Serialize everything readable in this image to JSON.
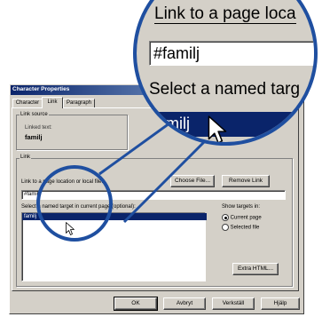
{
  "dialog": {
    "title": "Character Properties",
    "tabs": [
      "Character",
      "Link",
      "Paragraph"
    ],
    "link_source": {
      "group_label": "Link source",
      "linked_text_label": "Linked text:",
      "linked_text_value": "familj"
    },
    "link_group_label": "Link",
    "link_to_label": "Link to a page location or local file:",
    "link_to_value": "#familj",
    "choose_file_label": "Choose File...",
    "remove_link_label": "Remove Link",
    "named_target_label": "Select a named target in current page (optional):",
    "named_targets": [
      "familj"
    ],
    "show_targets_label": "Show targets in:",
    "radio_current": "Current page",
    "radio_selected": "Selected file",
    "extra_html_label": "Extra HTML...",
    "buttons": {
      "ok": "OK",
      "cancel": "Avbryt",
      "apply": "Verkställ",
      "help": "Hjälp"
    }
  },
  "zoom": {
    "link_to_label": "Link to a page loca",
    "link_to_value": "#familj",
    "named_target_label": "Select a named targ",
    "selected_item": "familj"
  },
  "colors": {
    "dialog_bg": "#d4d0c8",
    "title_gradient_start": "#0a246a",
    "title_gradient_end": "#a6caf0",
    "selection": "#0a246a",
    "zoom_ring": "#1f4fa0"
  }
}
